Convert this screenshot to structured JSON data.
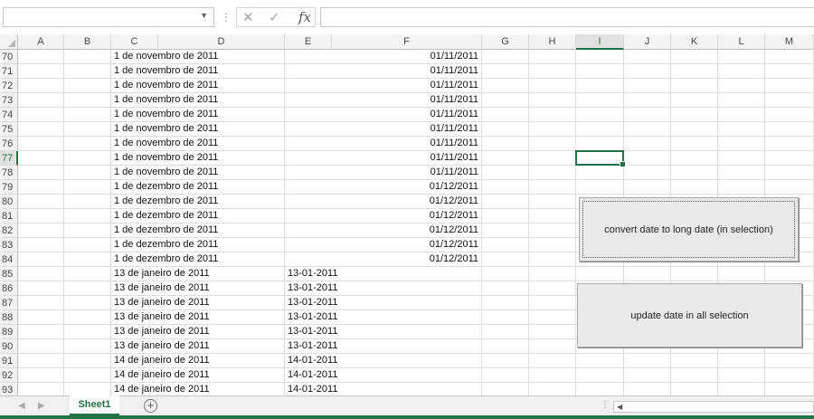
{
  "formula_bar": {
    "name_box": "",
    "cancel_icon": "close-icon",
    "enter_icon": "check-icon",
    "fx_label": "fx",
    "formula": ""
  },
  "columns": [
    "A",
    "B",
    "C",
    "D",
    "E",
    "F",
    "G",
    "H",
    "I",
    "J",
    "K",
    "L",
    "M"
  ],
  "selected_column": "I",
  "selected_row": "77",
  "rows": [
    {
      "num": "70",
      "c": "1 de novembro de 2011",
      "e": "",
      "f": "01/11/2011"
    },
    {
      "num": "71",
      "c": "1 de novembro de 2011",
      "e": "",
      "f": "01/11/2011"
    },
    {
      "num": "72",
      "c": "1 de novembro de 2011",
      "e": "",
      "f": "01/11/2011"
    },
    {
      "num": "73",
      "c": "1 de novembro de 2011",
      "e": "",
      "f": "01/11/2011"
    },
    {
      "num": "74",
      "c": "1 de novembro de 2011",
      "e": "",
      "f": "01/11/2011"
    },
    {
      "num": "75",
      "c": "1 de novembro de 2011",
      "e": "",
      "f": "01/11/2011"
    },
    {
      "num": "76",
      "c": "1 de novembro de 2011",
      "e": "",
      "f": "01/11/2011"
    },
    {
      "num": "77",
      "c": "1 de novembro de 2011",
      "e": "",
      "f": "01/11/2011"
    },
    {
      "num": "78",
      "c": "1 de novembro de 2011",
      "e": "",
      "f": "01/11/2011"
    },
    {
      "num": "79",
      "c": "1 de dezembro de 2011",
      "e": "",
      "f": "01/12/2011"
    },
    {
      "num": "80",
      "c": "1 de dezembro de 2011",
      "e": "",
      "f": "01/12/2011"
    },
    {
      "num": "81",
      "c": "1 de dezembro de 2011",
      "e": "",
      "f": "01/12/2011"
    },
    {
      "num": "82",
      "c": "1 de dezembro de 2011",
      "e": "",
      "f": "01/12/2011"
    },
    {
      "num": "83",
      "c": "1 de dezembro de 2011",
      "e": "",
      "f": "01/12/2011"
    },
    {
      "num": "84",
      "c": "1 de dezembro de 2011",
      "e": "",
      "f": "01/12/2011"
    },
    {
      "num": "85",
      "c": "13 de janeiro de 2011",
      "e": "13-01-2011",
      "f": ""
    },
    {
      "num": "86",
      "c": "13 de janeiro de 2011",
      "e": "13-01-2011",
      "f": ""
    },
    {
      "num": "87",
      "c": "13 de janeiro de 2011",
      "e": "13-01-2011",
      "f": ""
    },
    {
      "num": "88",
      "c": "13 de janeiro de 2011",
      "e": "13-01-2011",
      "f": ""
    },
    {
      "num": "89",
      "c": "13 de janeiro de 2011",
      "e": "13-01-2011",
      "f": ""
    },
    {
      "num": "90",
      "c": "13 de janeiro de 2011",
      "e": "13-01-2011",
      "f": ""
    },
    {
      "num": "91",
      "c": "14 de janeiro de 2011",
      "e": "14-01-2011",
      "f": ""
    },
    {
      "num": "92",
      "c": "14 de janeiro de 2011",
      "e": "14-01-2011",
      "f": ""
    },
    {
      "num": "93",
      "c": "14 de janeiro de 2011",
      "e": "14-01-2011",
      "f": ""
    }
  ],
  "buttons": {
    "convert": "convert date to long date (in selection)",
    "update": "update date in all selection"
  },
  "sheet_tabs": [
    "Sheet1"
  ],
  "colors": {
    "accent": "#217346"
  }
}
